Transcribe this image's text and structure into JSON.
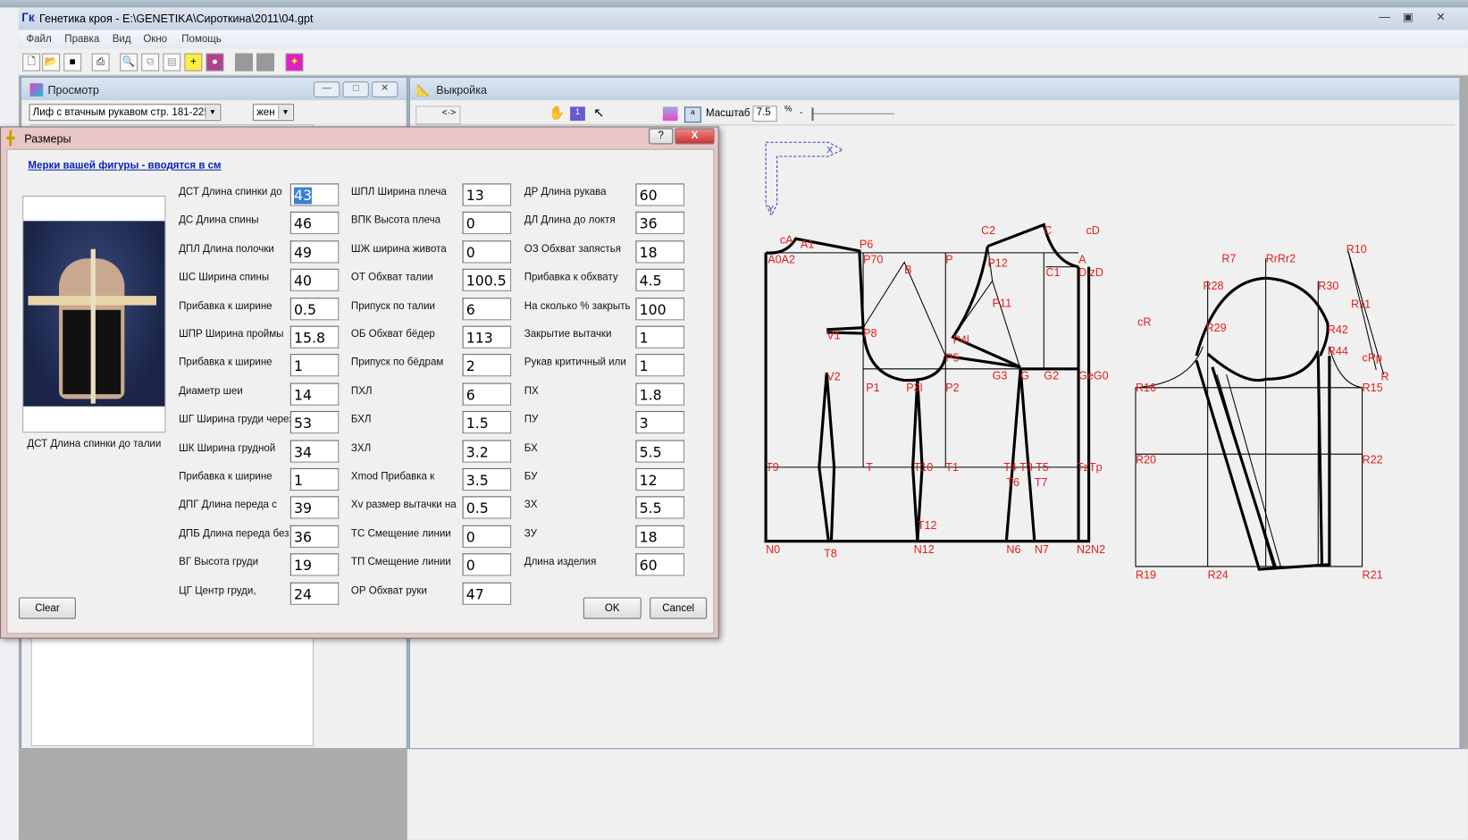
{
  "app": {
    "title": "Генетика кроя - E:\\GENETIKA\\Сироткина\\2011\\04.gpt",
    "icon": "гк-logo-icon"
  },
  "menu": [
    "Файл",
    "Правка",
    "Вид",
    "Окно",
    "Помощь"
  ],
  "toolbar": [
    "new-icon",
    "open-icon",
    "save-icon",
    "print-icon",
    "preview-icon",
    "copy-icon",
    "paste-icon",
    "measure-icon",
    "palette-icon",
    "gray-icon",
    "gray-icon",
    "magic-icon"
  ],
  "preview_window": {
    "title": "Просмотр",
    "pattern_select": "Лиф с втачным рукавом стр. 181-225",
    "gender_select": "жен"
  },
  "pattern_window": {
    "title": "Выкройка",
    "scale_label": "Масштаб",
    "scale_value": "7.5",
    "scale_unit": "%",
    "axis_x": "X",
    "axis_y": "Y",
    "point_labels": [
      "cA",
      "A1",
      "P6",
      "A0A2",
      "P70",
      "P",
      "C2",
      "C",
      "cD",
      "P12",
      "A",
      "C1",
      "D zD",
      "B",
      "P11",
      "cR",
      "V1",
      "P8",
      "P4l",
      "P5",
      "G3",
      "G",
      "G2",
      "GeG0",
      "V2",
      "P1",
      "P3l",
      "P2",
      "T9",
      "T",
      "T10",
      "T1",
      "T4 T3 T5",
      "TzTp",
      "T6",
      "T7",
      "T12",
      "N0",
      "T8",
      "N12",
      "N6",
      "N7",
      "N2N2",
      "R7",
      "RrRr2",
      "R10",
      "R28",
      "R30",
      "R11",
      "R29",
      "R42",
      "R44",
      "cRp",
      "R",
      "R16",
      "R15",
      "R20",
      "R22",
      "R19",
      "R24",
      "R21"
    ]
  },
  "dialog": {
    "title": "Размеры",
    "help": "?",
    "close": "X",
    "header_link": "Мерки вашей фигуры - вводятся в см",
    "photo_caption": "ДСТ Длина спинки до талии",
    "clear": "Clear",
    "ok": "OK",
    "cancel": "Cancel",
    "columns": [
      [
        {
          "label": "ДСТ Длина спинки до",
          "value": "43"
        },
        {
          "label": "ДС Длина спины",
          "value": "46"
        },
        {
          "label": "ДПЛ Длина полочки",
          "value": "49"
        },
        {
          "label": "ШС Ширина спины",
          "value": "40"
        },
        {
          "label": "Прибавка к ширине",
          "value": "0.5"
        },
        {
          "label": "ШПР Ширина проймы",
          "value": "15.8"
        },
        {
          "label": "Прибавка к ширине",
          "value": "1"
        },
        {
          "label": "Диаметр шеи",
          "value": "14"
        },
        {
          "label": "ШГ Ширина груди через",
          "value": "53"
        },
        {
          "label": "ШК Ширина грудной",
          "value": "34"
        },
        {
          "label": "Прибавка к ширине",
          "value": "1"
        },
        {
          "label": "ДПГ Длина переда с",
          "value": "39"
        },
        {
          "label": "ДПБ Длина переда без",
          "value": "36"
        },
        {
          "label": "ВГ Высота груди",
          "value": "19"
        },
        {
          "label": "ЦГ Центр груди,",
          "value": "24"
        }
      ],
      [
        {
          "label": "ШПЛ Ширина плеча",
          "value": "13"
        },
        {
          "label": "ВПК Высота плеча",
          "value": "0"
        },
        {
          "label": "ШЖ ширина живота",
          "value": "0"
        },
        {
          "label": "ОТ Обхват талии",
          "value": "100.5"
        },
        {
          "label": "Припуск по талии",
          "value": "6"
        },
        {
          "label": "ОБ Обхват бёдер",
          "value": "113"
        },
        {
          "label": "Припуск по бёдрам",
          "value": "2"
        },
        {
          "label": "ПХЛ",
          "value": "6"
        },
        {
          "label": "БХЛ",
          "value": "1.5"
        },
        {
          "label": "ЗХЛ",
          "value": "3.2"
        },
        {
          "label": "Xmod Прибавка к",
          "value": "3.5"
        },
        {
          "label": "Xv размер вытачки на",
          "value": "0.5"
        },
        {
          "label": "ТС Смещение линии",
          "value": "0"
        },
        {
          "label": "ТП Смещение линии",
          "value": "0"
        },
        {
          "label": "ОР Обхват руки",
          "value": "47"
        }
      ],
      [
        {
          "label": "ДР Длина рукава",
          "value": "60"
        },
        {
          "label": "ДЛ Длина до локтя",
          "value": "36"
        },
        {
          "label": "ОЗ Обхват запястья",
          "value": "18"
        },
        {
          "label": "Прибавка к обхвату",
          "value": "4.5"
        },
        {
          "label": "На сколько % закрыть",
          "value": "100"
        },
        {
          "label": "Закрытие вытачки",
          "value": "1"
        },
        {
          "label": "Рукав критичный или",
          "value": "1"
        },
        {
          "label": "ПХ",
          "value": "1.8"
        },
        {
          "label": "ПУ",
          "value": "3"
        },
        {
          "label": "БХ",
          "value": "5.5"
        },
        {
          "label": "БУ",
          "value": "12"
        },
        {
          "label": "ЗХ",
          "value": "5.5"
        },
        {
          "label": "ЗУ",
          "value": "18"
        },
        {
          "label": "Длина изделия",
          "value": "60"
        }
      ]
    ]
  },
  "colors": {
    "point_label": "#e0201e",
    "link": "#0a24b8",
    "selection": "#3b7fd6"
  }
}
